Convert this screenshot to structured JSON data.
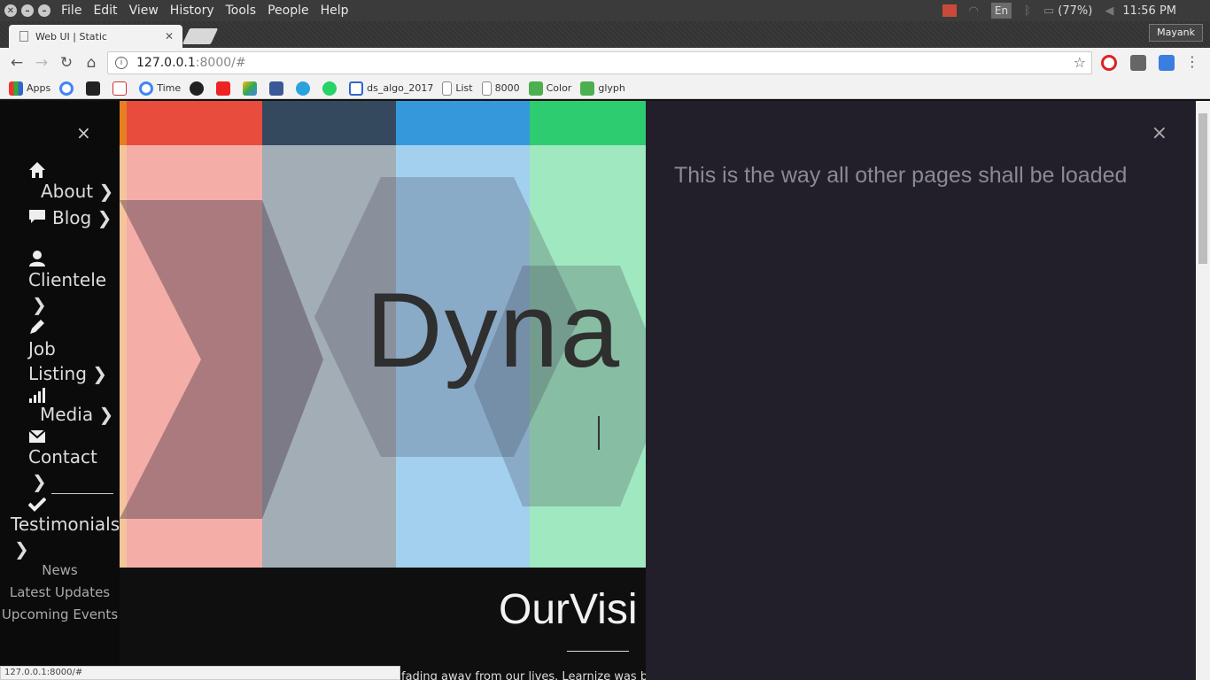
{
  "os": {
    "menu": [
      "File",
      "Edit",
      "View",
      "History",
      "Tools",
      "People",
      "Help"
    ],
    "language": "En",
    "battery": "(77%)",
    "clock": "11:56 PM"
  },
  "browser": {
    "tab_title": "Web UI | Static",
    "profile": "Mayank",
    "url_host": "127.0.0.1",
    "url_rest": ":8000/#",
    "bookmarks": [
      "Apps",
      "Time",
      "ds_algo_2017",
      "List",
      "8000",
      "Color",
      "glyph"
    ],
    "status_url": "127.0.0.1:8000/#"
  },
  "sidebar": {
    "close": "×",
    "items": {
      "about": "About",
      "blog": "Blog",
      "clientele": "Clientele",
      "job1": "Job",
      "job2": "Listing",
      "media": "Media",
      "contact": "Contact",
      "testimonials": "Testimonials"
    },
    "sub": [
      "News",
      "Latest Updates",
      "Upcoming Events"
    ]
  },
  "hero": {
    "title": "Dyna",
    "colors": [
      "#e74c3c",
      "#34495e",
      "#3498db",
      "#2ecc71"
    ]
  },
  "vision": {
    "title": "OurVisi",
    "text": "fading away from our lives. Learnize was be"
  },
  "panel": {
    "close": "×",
    "message": "This is the way all other pages shall be loaded"
  }
}
